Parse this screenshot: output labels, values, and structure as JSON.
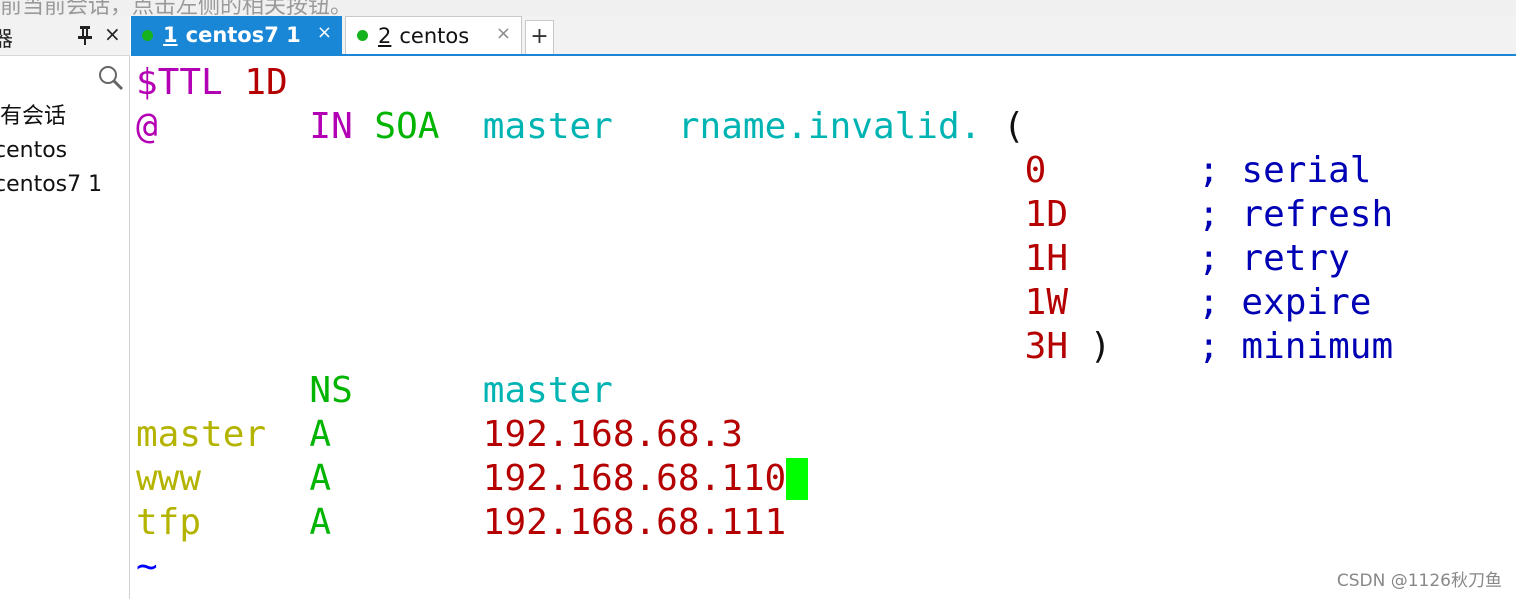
{
  "hint_text": "前当前会话，点击左侧的相关按钮。",
  "panel": {
    "title": "器",
    "close": "×",
    "search_placeholder": "",
    "sessions": [
      "所有会话",
      "centos",
      "centos7 1"
    ]
  },
  "tabs": [
    {
      "num": "1",
      "label": "centos7 1",
      "close": "×",
      "active": true,
      "status_color": "#17b31f"
    },
    {
      "num": "2",
      "label": "centos",
      "close": "×",
      "active": false,
      "status_color": "#17b31f"
    }
  ],
  "add_tab": "+",
  "terminal": {
    "lines": [
      [
        {
          "t": "$TTL ",
          "c": "magenta"
        },
        {
          "t": "1D",
          "c": "red"
        }
      ],
      [
        {
          "t": "@       ",
          "c": "magenta"
        },
        {
          "t": "IN ",
          "c": "magenta"
        },
        {
          "t": "SOA  ",
          "c": "green"
        },
        {
          "t": "master   ",
          "c": "cyan"
        },
        {
          "t": "rname.invalid. ",
          "c": "cyan"
        },
        {
          "t": "(",
          "c": "black"
        }
      ],
      [
        {
          "t": "                                         ",
          "c": "black"
        },
        {
          "t": "0",
          "c": "red"
        },
        {
          "t": "       ",
          "c": "black"
        },
        {
          "t": "; serial",
          "c": "blue"
        }
      ],
      [
        {
          "t": "                                         ",
          "c": "black"
        },
        {
          "t": "1D",
          "c": "red"
        },
        {
          "t": "      ",
          "c": "black"
        },
        {
          "t": "; refresh",
          "c": "blue"
        }
      ],
      [
        {
          "t": "                                         ",
          "c": "black"
        },
        {
          "t": "1H",
          "c": "red"
        },
        {
          "t": "      ",
          "c": "black"
        },
        {
          "t": "; retry",
          "c": "blue"
        }
      ],
      [
        {
          "t": "                                         ",
          "c": "black"
        },
        {
          "t": "1W",
          "c": "red"
        },
        {
          "t": "      ",
          "c": "black"
        },
        {
          "t": "; expire",
          "c": "blue"
        }
      ],
      [
        {
          "t": "                                         ",
          "c": "black"
        },
        {
          "t": "3H",
          "c": "red"
        },
        {
          "t": " )    ",
          "c": "black"
        },
        {
          "t": "; minimum",
          "c": "blue"
        }
      ],
      [
        {
          "t": "        ",
          "c": "black"
        },
        {
          "t": "NS      ",
          "c": "green"
        },
        {
          "t": "master",
          "c": "cyan"
        }
      ],
      [
        {
          "t": "master  ",
          "c": "olive"
        },
        {
          "t": "A       ",
          "c": "green"
        },
        {
          "t": "192.168.68.3",
          "c": "red"
        }
      ],
      [
        {
          "t": "www     ",
          "c": "olive"
        },
        {
          "t": "A       ",
          "c": "green"
        },
        {
          "t": "192.168.68.110",
          "c": "red"
        }
      ],
      [
        {
          "t": "tfp     ",
          "c": "olive"
        },
        {
          "t": "A       ",
          "c": "green"
        },
        {
          "t": "192.168.68.111",
          "c": "red"
        }
      ],
      [
        {
          "t": "~",
          "c": "tilde"
        }
      ]
    ],
    "cursor_line": 9
  },
  "watermark": "CSDN @1126秋刀鱼",
  "colors": {
    "accent": "#1a86d6",
    "status_dot": "#17b31f",
    "cursor": "#00ff00"
  }
}
